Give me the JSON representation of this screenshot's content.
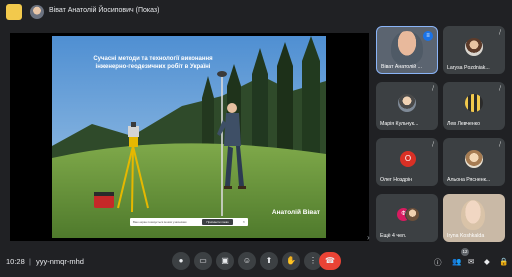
{
  "header": {
    "title": "Віват Анатолій Йосипович (Показ)"
  },
  "slide": {
    "title": "Сучасні методи та технології виконання інженерно-геодезичних робіт в Україні",
    "author": "Анатолій Віват",
    "info_strip_text": "Ваш екран показується іншим учасникам",
    "info_strip_button": "Припинити показ"
  },
  "participants": [
    {
      "name": "Віват Анатолій Йосипович",
      "display": "Віват Анатолій ...",
      "speaking": true
    },
    {
      "name": "Laryssa Pozdniak",
      "display": "Larysa Pozdniak...",
      "mic_off": true
    },
    {
      "name": "Марія Кульчук",
      "display": "Марія Кульчук...",
      "mic_off": true
    },
    {
      "name": "Лев Левченко",
      "display": "Лев Левченко",
      "mic_off": true
    },
    {
      "name": "Олег Ноздрін",
      "display": "Олег Ноздрін",
      "mic_off": true,
      "avatar_letter": "О"
    },
    {
      "name": "Альона Рясненко",
      "display": "Альона Рясненк...",
      "mic_off": true
    },
    {
      "name": "Ще 4 чел.",
      "display": "Ещё 4 чел.",
      "avatar_letter": "Ф"
    },
    {
      "name": "Iryna Koshkalda",
      "display": "Iryna Koshkalda"
    }
  ],
  "bottom": {
    "time": "10:28",
    "separator": "|",
    "meeting_code": "yyy-nmqr-mhd",
    "people_count": "12"
  },
  "icons": {
    "mic": "microphone-icon",
    "camera": "camera-icon",
    "captions": "captions-icon",
    "emoji": "emoji-icon",
    "present": "present-icon",
    "hand": "raise-hand-icon",
    "more": "more-options-icon",
    "leave": "leave-call-icon"
  },
  "colors": {
    "accent": "#1a73e8",
    "leave": "#ea4335",
    "bg": "#202124",
    "tile": "#3c4043"
  }
}
